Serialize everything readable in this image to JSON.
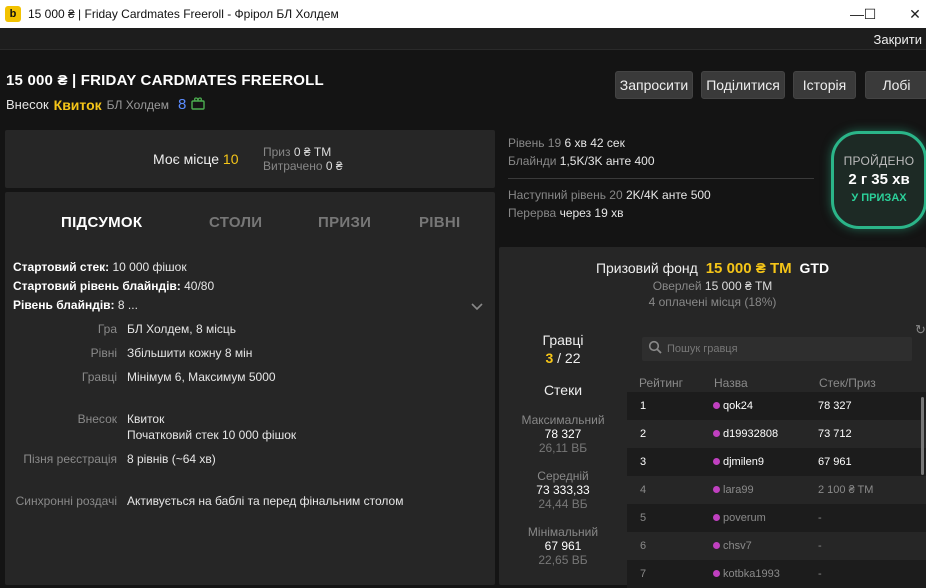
{
  "window": {
    "title": "15 000 ₴ | Friday Cardmates Freeroll - Фрірол БЛ Холдем",
    "logo": "b",
    "minimize_icon": "—",
    "maximize_icon": "☐",
    "close_icon": "✕"
  },
  "menubar": {
    "close_label": "Закрити"
  },
  "header": {
    "tournament_name": "15 000 ₴ | FRIDAY CARDMATES FREEROLL",
    "buyin_label": "Внесок",
    "buyin_ticket": "Квиток",
    "game_type": "БЛ Холдем",
    "tables_count": "8",
    "buttons": {
      "invite": "Запросити",
      "share": "Поділитися",
      "history": "Історія",
      "lobby": "Лобі"
    }
  },
  "my_place": {
    "label": "Моє місце",
    "value": "10",
    "prize_label": "Приз",
    "prize_value": "0 ₴ TM",
    "spent_label": "Витрачено",
    "spent_value": "0 ₴"
  },
  "level": {
    "current_label": "Рівень 19",
    "current_time": "6 хв 42 сек",
    "blinds_label": "Блайнди",
    "blinds_value": "1,5K/3K анте 400",
    "next_label": "Наступний рівень 20",
    "next_value": "2K/4K анте 500",
    "break_label": "Перерва",
    "break_value": "через 19 хв"
  },
  "status": {
    "label": "ПРОЙДЕНО",
    "time": "2 г 35 хв",
    "state": "У ПРИЗАХ"
  },
  "summary": {
    "tabs": [
      "ПІДСУМОК",
      "СТОЛИ",
      "ПРИЗИ",
      "РІВНІ"
    ],
    "start_stack_label": "Стартовий стек:",
    "start_stack_value": " 10 000 фішок",
    "start_blinds_label": "Стартовий рівень блайндів:",
    "start_blinds_value": " 40/80",
    "blind_level_label": "Рівень блайндів:",
    "blind_level_value": " 8 ...",
    "chevron": "⌄",
    "details": {
      "game_key": "Гра",
      "game_val": "БЛ Холдем, 8 місць",
      "levels_key": "Рівні",
      "levels_val": "Збільшити кожну 8 мін",
      "players_key": "Гравці",
      "players_val": "Мінімум 6, Максимум 5000",
      "buyin_key": "Внесок",
      "buyin_val1": "Квиток",
      "buyin_val2": "Початковий стек 10 000 фішок",
      "late_key": "Пізня реєстрація",
      "late_val": "8 рівнів (~64 хв)",
      "sync_key": "Синхронні роздачі",
      "sync_val": "Активується на баблі та перед фінальним столом"
    }
  },
  "prize_pool": {
    "label": "Призовий фонд",
    "amount": "15 000 ₴ TM",
    "gtd": "GTD",
    "overlay_label": "Оверлей",
    "overlay_value": "15 000 ₴ TM",
    "paid_places": "4 оплачені місця (18%)"
  },
  "players": {
    "label": "Гравці",
    "current": "3",
    "total": " / 22",
    "stacks_label": "Стеки",
    "max_label": "Максимальний",
    "max_value": "78 327",
    "max_bb": "26,11 ВБ",
    "avg_label": "Середній",
    "avg_value": "73 333,33",
    "avg_bb": "24,44 ВБ",
    "min_label": "Мінімальний",
    "min_value": "67 961",
    "min_bb": "22,65 ВБ"
  },
  "search": {
    "placeholder": "Пошук гравця",
    "icon": "⚲"
  },
  "refresh_icon": "↻",
  "table": {
    "headers": [
      "Рейтинг",
      "Назва",
      "Стек/Приз"
    ],
    "rows": [
      {
        "rank": "1",
        "name": "qok24",
        "stack": "78 327"
      },
      {
        "rank": "2",
        "name": "d19932808",
        "stack": "73 712"
      },
      {
        "rank": "3",
        "name": "djmilen9",
        "stack": "67 961"
      },
      {
        "rank": "4",
        "name": "lara99",
        "stack": "2 100 ₴ TM"
      },
      {
        "rank": "5",
        "name": "poverum",
        "stack": "-"
      },
      {
        "rank": "6",
        "name": "chsv7",
        "stack": "-"
      },
      {
        "rank": "7",
        "name": "kotbka1993",
        "stack": "-"
      }
    ]
  },
  "colors": {
    "accent_yellow": "#f5c518",
    "status_green": "#2bb589",
    "player_dot": "#c040c0",
    "tables_blue": "#5b8cff"
  }
}
